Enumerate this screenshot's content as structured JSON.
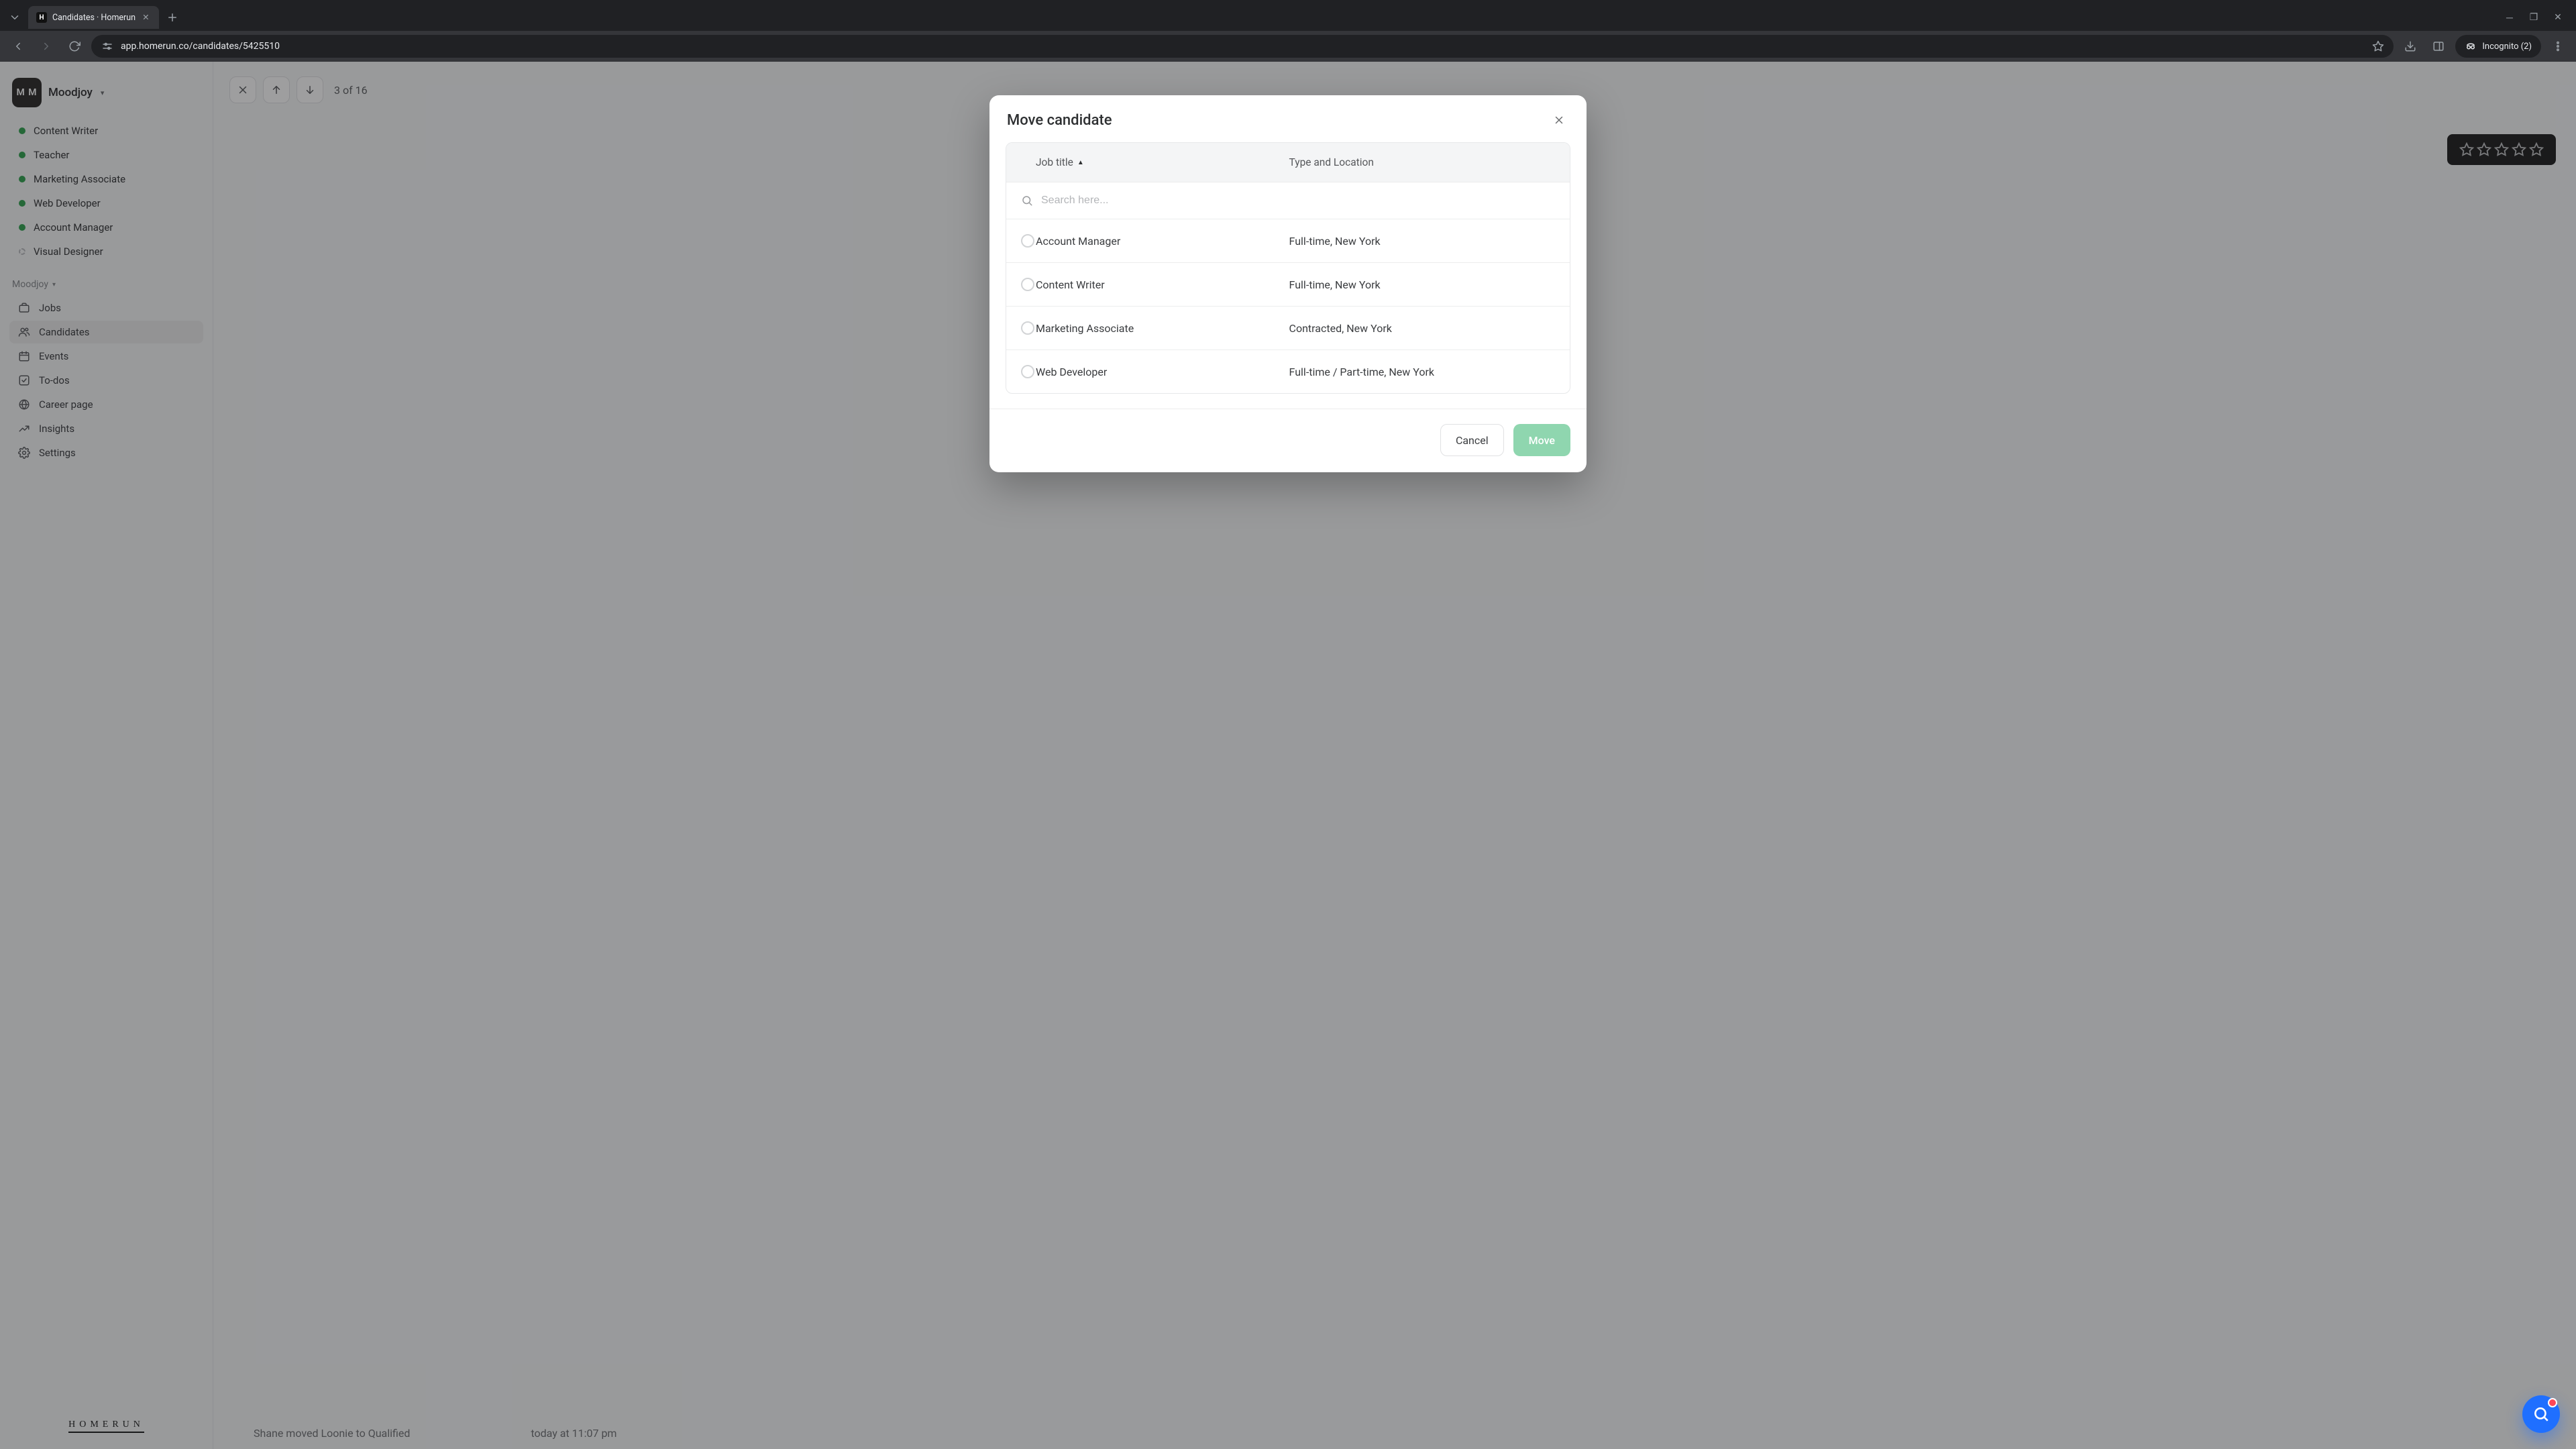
{
  "browser": {
    "tab_title": "Candidates · Homerun",
    "url": "app.homerun.co/candidates/5425510",
    "incognito_label": "Incognito (2)"
  },
  "workspace": {
    "initials": "M M",
    "name": "Moodjoy"
  },
  "jobs": [
    {
      "label": "Content Writer",
      "status": "green"
    },
    {
      "label": "Teacher",
      "status": "green"
    },
    {
      "label": "Marketing Associate",
      "status": "green"
    },
    {
      "label": "Web Developer",
      "status": "green"
    },
    {
      "label": "Account Manager",
      "status": "green"
    },
    {
      "label": "Visual Designer",
      "status": "grey"
    }
  ],
  "section_label": "Moodjoy",
  "nav": [
    {
      "label": "Jobs",
      "icon": "briefcase",
      "active": false
    },
    {
      "label": "Candidates",
      "icon": "users",
      "active": true
    },
    {
      "label": "Events",
      "icon": "calendar",
      "active": false
    },
    {
      "label": "To-dos",
      "icon": "check",
      "active": false
    },
    {
      "label": "Career page",
      "icon": "globe",
      "active": false
    },
    {
      "label": "Insights",
      "icon": "chart",
      "active": false
    },
    {
      "label": "Settings",
      "icon": "gear",
      "active": false
    }
  ],
  "brand": "HOMERUN",
  "pager": {
    "text": "3 of 16"
  },
  "activity": {
    "text": "Shane moved Loonie to Qualified",
    "time": "today at 11:07 pm"
  },
  "modal": {
    "title": "Move candidate",
    "columns": {
      "job": "Job title",
      "meta": "Type and Location"
    },
    "search_placeholder": "Search here...",
    "rows": [
      {
        "title": "Account Manager",
        "meta": "Full-time, New York"
      },
      {
        "title": "Content Writer",
        "meta": "Full-time, New York"
      },
      {
        "title": "Marketing Associate",
        "meta": "Contracted, New York"
      },
      {
        "title": "Web Developer",
        "meta": "Full-time / Part-time, New York"
      }
    ],
    "cancel": "Cancel",
    "confirm": "Move"
  }
}
